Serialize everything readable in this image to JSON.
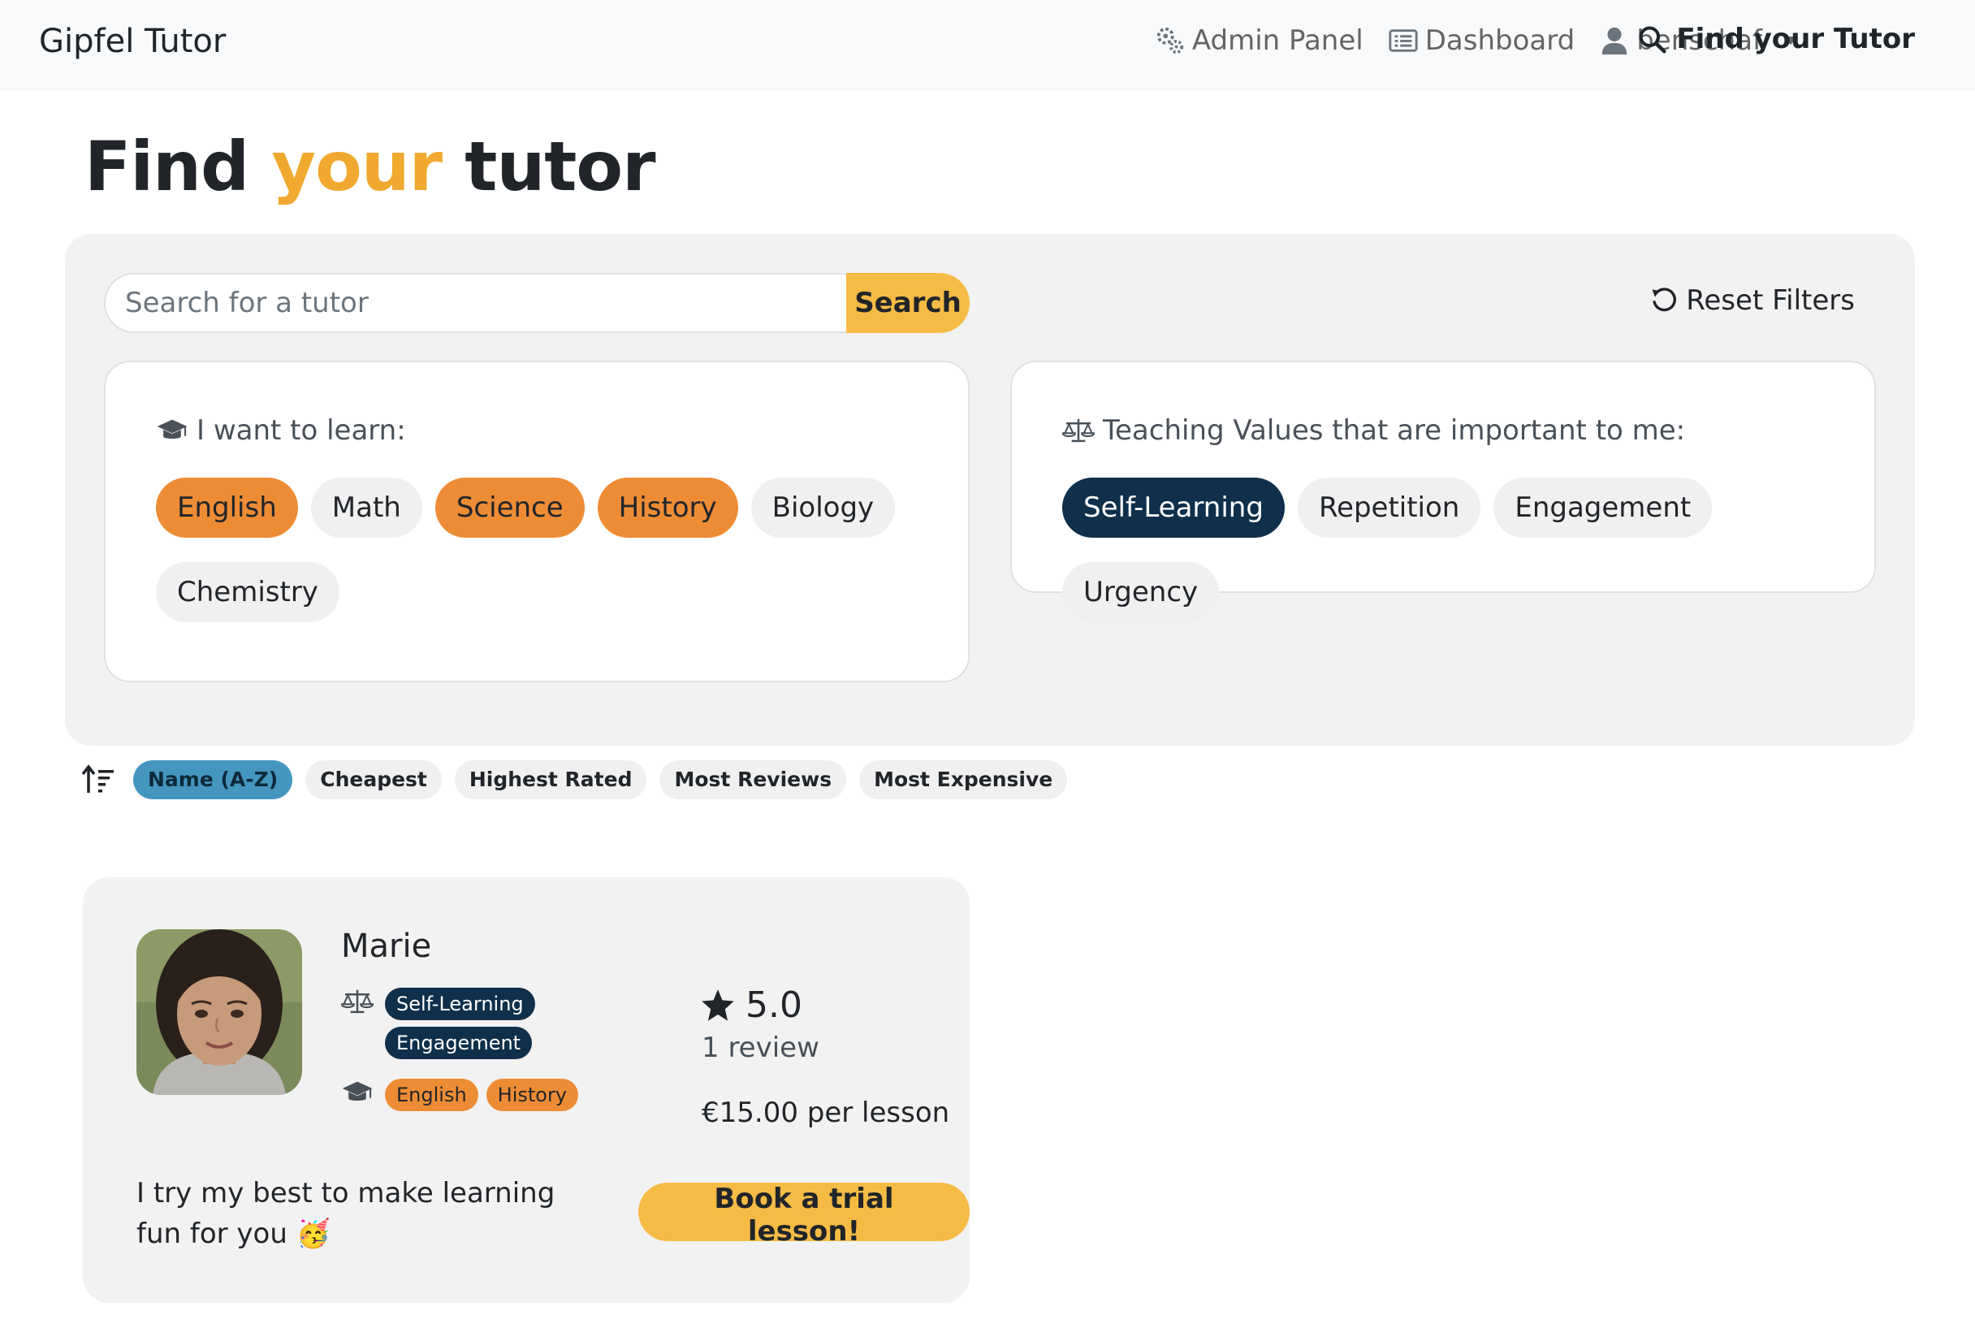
{
  "navbar": {
    "brand": "Gipfel Tutor",
    "admin_panel": "Admin Panel",
    "dashboard": "Dashboard",
    "user": "benschaf",
    "find_tutor": "Find your Tutor"
  },
  "page": {
    "title_part1": "Find ",
    "title_accent": "your",
    "title_part2": " tutor"
  },
  "search": {
    "placeholder": "Search for a tutor",
    "value": "",
    "button": "Search",
    "reset": "Reset Filters"
  },
  "learn": {
    "heading": "I want to learn:",
    "subjects": [
      {
        "label": "English",
        "selected": true
      },
      {
        "label": "Math",
        "selected": false
      },
      {
        "label": "Science",
        "selected": true
      },
      {
        "label": "History",
        "selected": true
      },
      {
        "label": "Biology",
        "selected": false
      },
      {
        "label": "Chemistry",
        "selected": false
      }
    ]
  },
  "values": {
    "heading": "Teaching Values that are important to me:",
    "items": [
      {
        "label": "Self-Learning",
        "selected": true
      },
      {
        "label": "Repetition",
        "selected": false
      },
      {
        "label": "Engagement",
        "selected": false
      },
      {
        "label": "Urgency",
        "selected": false
      }
    ]
  },
  "sort": {
    "options": [
      {
        "label": "Name (A-Z)",
        "active": true
      },
      {
        "label": "Cheapest",
        "active": false
      },
      {
        "label": "Highest Rated",
        "active": false
      },
      {
        "label": "Most Reviews",
        "active": false
      },
      {
        "label": "Most Expensive",
        "active": false
      }
    ]
  },
  "tutor": {
    "name": "Marie",
    "values": [
      "Self-Learning",
      "Engagement"
    ],
    "subjects": [
      "English",
      "History"
    ],
    "rating": "5.0",
    "reviews": "1 review",
    "price": "€15.00 per lesson",
    "bio": "I try my best to make learning fun for you 🥳",
    "book_button": "Book a trial lesson!"
  },
  "colors": {
    "accent_yellow": "#f6bb45",
    "accent_orange": "#ee8c35",
    "navy": "#0f2f4a",
    "sort_active": "#4596bf"
  }
}
